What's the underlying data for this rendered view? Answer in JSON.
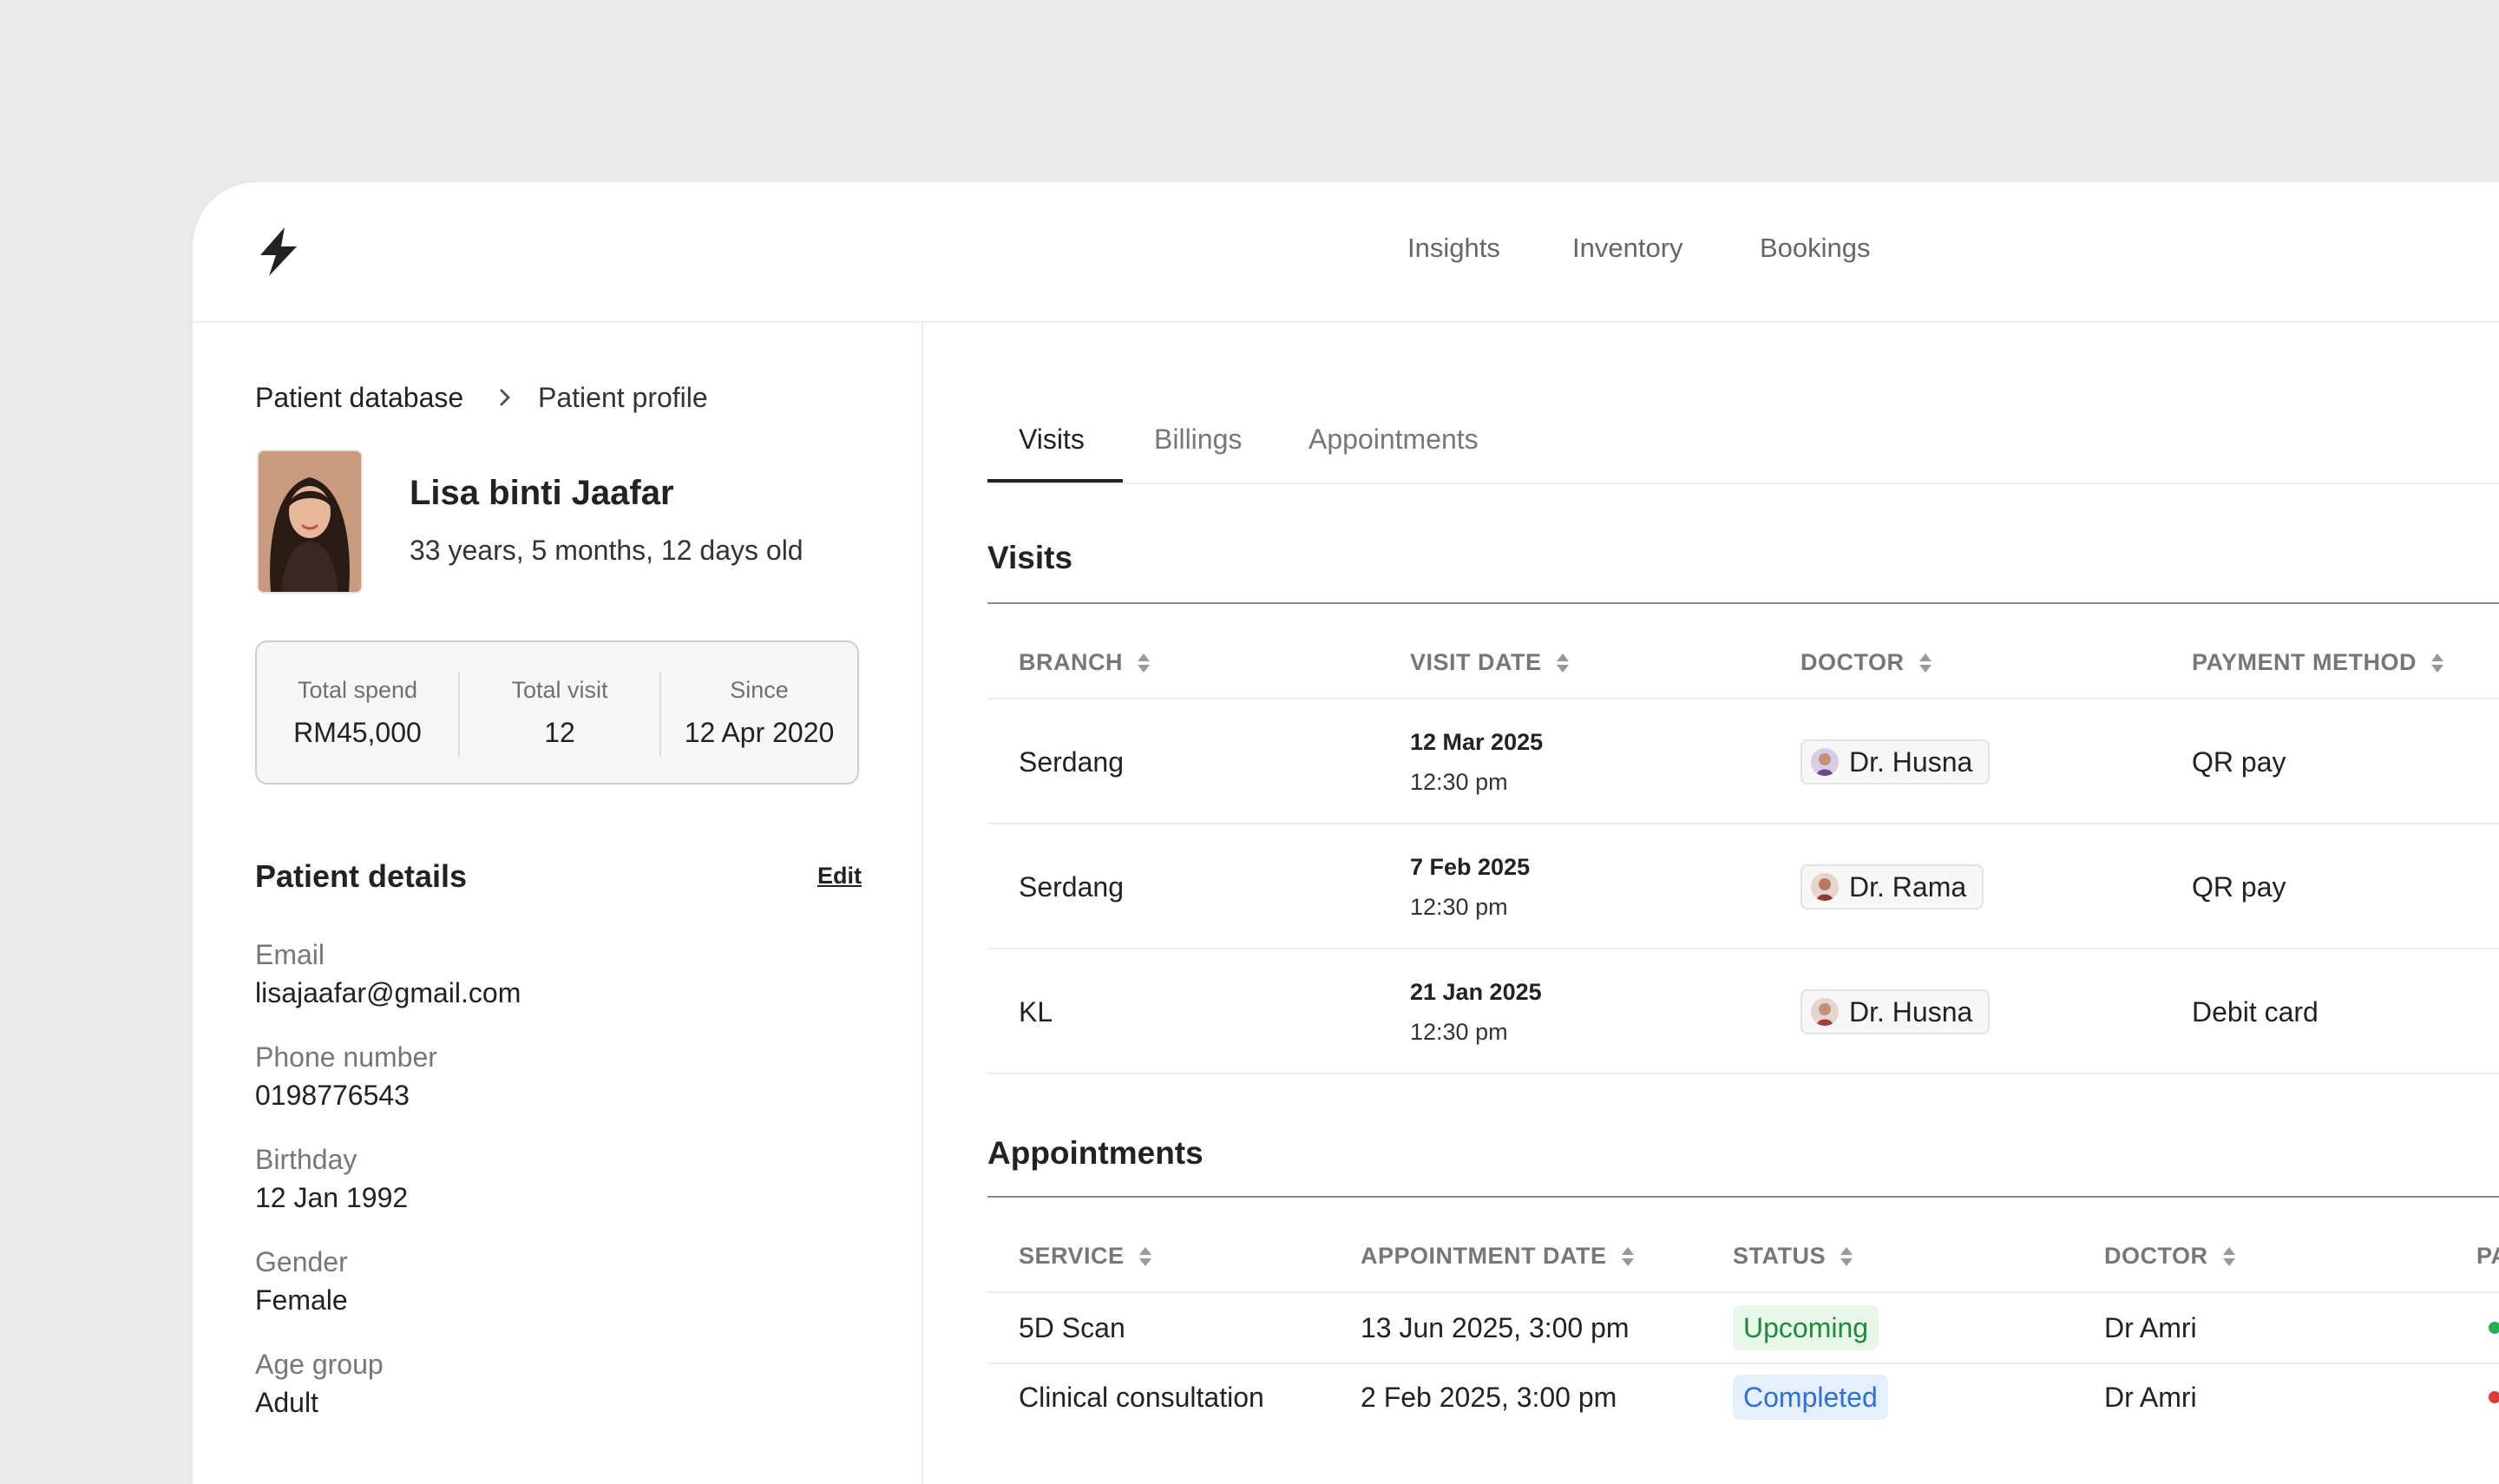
{
  "nav": {
    "items": [
      "Insights",
      "Inventory",
      "Bookings"
    ]
  },
  "breadcrumb": {
    "parent": "Patient database",
    "current": "Patient profile"
  },
  "patient": {
    "name": "Lisa binti Jaafar",
    "age": "33 years, 5 months, 12 days old"
  },
  "stats": [
    {
      "label": "Total spend",
      "value": "RM45,000"
    },
    {
      "label": "Total visit",
      "value": "12"
    },
    {
      "label": "Since",
      "value": "12 Apr 2020"
    }
  ],
  "details": {
    "title": "Patient details",
    "edit_label": "Edit",
    "fields": [
      {
        "label": "Email",
        "value": "lisajaafar@gmail.com"
      },
      {
        "label": "Phone number",
        "value": "0198776543"
      },
      {
        "label": "Birthday",
        "value": "12 Jan 1992"
      },
      {
        "label": "Gender",
        "value": "Female"
      },
      {
        "label": "Age group",
        "value": "Adult"
      }
    ]
  },
  "tabs": [
    {
      "label": "Visits",
      "active": true
    },
    {
      "label": "Billings",
      "active": false
    },
    {
      "label": "Appointments",
      "active": false
    }
  ],
  "visits": {
    "title": "Visits",
    "headers": [
      "BRANCH",
      "VISIT DATE",
      "DOCTOR",
      "PAYMENT METHOD"
    ],
    "rows": [
      {
        "branch": "Serdang",
        "date": "12 Mar 2025",
        "time": "12:30 pm",
        "doctor": "Dr. Husna",
        "payment": "QR pay"
      },
      {
        "branch": "Serdang",
        "date": "7 Feb 2025",
        "time": "12:30 pm",
        "doctor": "Dr. Rama",
        "payment": "QR pay"
      },
      {
        "branch": "KL",
        "date": "21 Jan 2025",
        "time": "12:30 pm",
        "doctor": "Dr. Husna",
        "payment": "Debit card"
      }
    ]
  },
  "appointments": {
    "title": "Appointments",
    "headers": [
      "SERVICE",
      "APPOINTMENT DATE",
      "STATUS",
      "DOCTOR",
      "PA"
    ],
    "rows": [
      {
        "service": "5D Scan",
        "date": "13 Jun 2025, 3:00 pm",
        "status": "Upcoming",
        "doctor": "Dr Amri"
      },
      {
        "service": "Clinical consultation",
        "date": "2 Feb 2025, 3:00 pm",
        "status": "Completed",
        "doctor": "Dr Amri"
      }
    ]
  },
  "colors": {
    "upcoming_bg": "#e8f7ea",
    "upcoming_text": "#1f8a3b",
    "completed_bg": "#e6effc",
    "completed_text": "#2f6fd6",
    "dot_green": "#22b24c",
    "dot_red": "#e23a3a"
  }
}
